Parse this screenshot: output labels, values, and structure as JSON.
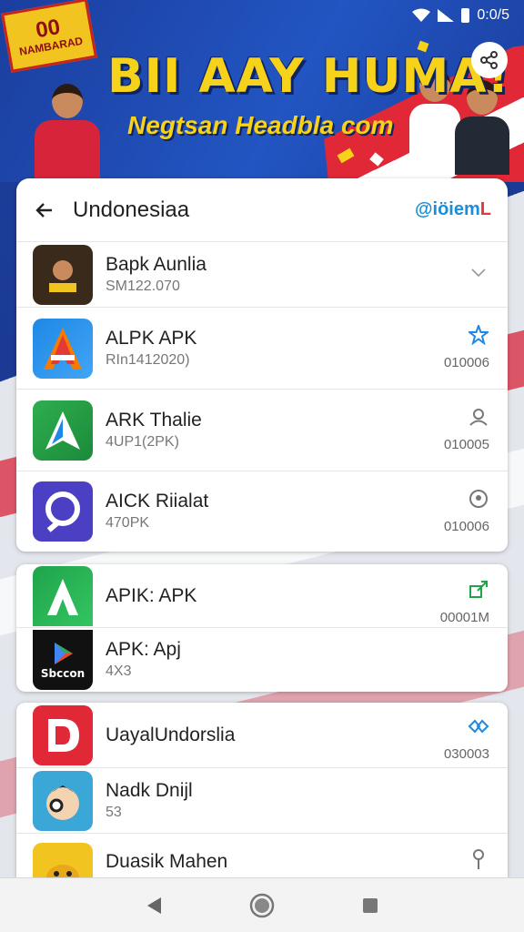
{
  "status_bar": {
    "time": "0:0/5"
  },
  "banner": {
    "badge_number": "00",
    "badge_text": "NAMBARAD",
    "headline": "BII AAY HUMA!",
    "subline": "Negtsan Headbla com"
  },
  "header": {
    "title": "Undonesiaa",
    "brand_prefix": "@iöiem",
    "brand_suffix": "L"
  },
  "apps_main": [
    {
      "name": "Bapk Aunlia",
      "sub": "SM122.070",
      "size": "",
      "icon": "chevron-down-icon",
      "color": "#3a2a1c"
    },
    {
      "name": "ALPK APK",
      "sub": "RIn1412020)",
      "size": "010006",
      "icon": "star-person-icon",
      "color": "#1e88e5"
    },
    {
      "name": "ARK Thalie",
      "sub": "4UP1(2PK)",
      "size": "010005",
      "icon": "person-icon",
      "color": "#2eae4f"
    },
    {
      "name": "AICK Riialat",
      "sub": "470PK",
      "size": "010006",
      "icon": "profile-icon",
      "color": "#4b3fc4"
    }
  ],
  "apps_group2": [
    {
      "name": "APIK: APK",
      "sub": "",
      "size": "00001M",
      "icon": "open-external-icon",
      "color": "#1fa44a"
    },
    {
      "name": "APK: Apj",
      "sub": "4X3",
      "size": "",
      "icon": "",
      "color": "#111111",
      "icon_label": "Sbccon"
    }
  ],
  "apps_group3": [
    {
      "name": "UayalUndorslia",
      "sub": "",
      "size": "030003",
      "icon": "link-icon",
      "color": "#e02836"
    },
    {
      "name": "Nadk Dnijl",
      "sub": "53",
      "size": "",
      "icon": "",
      "color": "#3aa7d6"
    },
    {
      "name": "Duasik Mahen",
      "sub": "",
      "size": "",
      "icon": "pin-icon",
      "color": "#f2c420"
    }
  ]
}
